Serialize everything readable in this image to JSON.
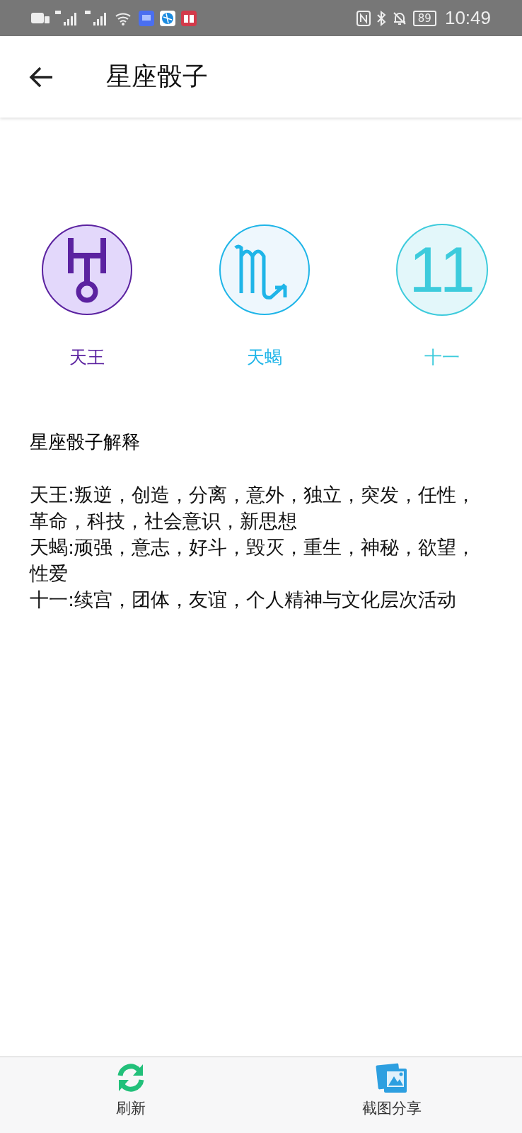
{
  "status_bar": {
    "battery": "89",
    "time": "10:49"
  },
  "app_bar": {
    "title": "星座骰子"
  },
  "dice": [
    {
      "kind": "planet",
      "label": "天王",
      "color": "#5b22a0"
    },
    {
      "kind": "sign",
      "label": "天蝎",
      "color": "#1fb5e8"
    },
    {
      "kind": "house",
      "symbol": "11",
      "label": "十一",
      "color": "#3dcbdc"
    }
  ],
  "explanation": {
    "title": "星座骰子解释",
    "lines": [
      "天王:叛逆，创造，分离，意外，独立，突发，任性，革命，科技，社会意识，新思想",
      "天蝎:顽强，意志，好斗，毁灭，重生，神秘，欲望，性爱",
      "十一:续宫，团体，友谊，个人精神与文化层次活动"
    ]
  },
  "bottom_bar": [
    {
      "kind": "refresh",
      "label": "刷新"
    },
    {
      "kind": "share",
      "label": "截图分享"
    }
  ]
}
